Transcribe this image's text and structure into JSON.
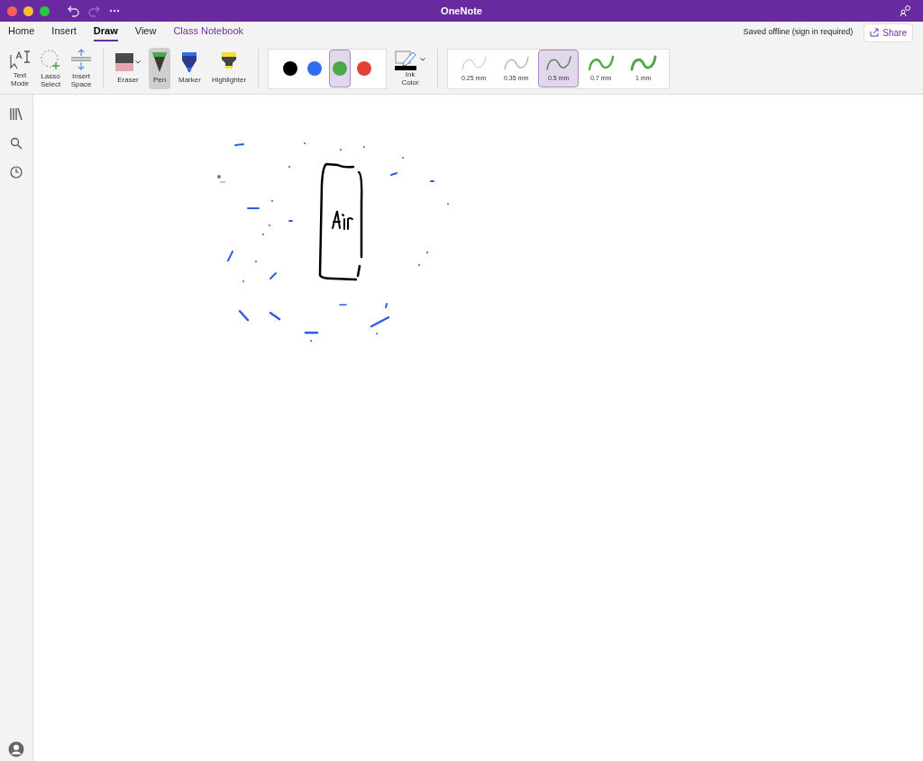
{
  "window": {
    "title": "OneNote"
  },
  "tabs": [
    {
      "label": "Home",
      "selected": false,
      "kind": "normal"
    },
    {
      "label": "Insert",
      "selected": false,
      "kind": "normal"
    },
    {
      "label": "Draw",
      "selected": true,
      "kind": "normal"
    },
    {
      "label": "View",
      "selected": false,
      "kind": "normal"
    },
    {
      "label": "Class Notebook",
      "selected": false,
      "kind": "accent"
    }
  ],
  "status": "Saved offline (sign in required)",
  "share_button": "Share",
  "mode_tools": [
    {
      "kind": "text",
      "label": "Text Mode"
    },
    {
      "kind": "lasso",
      "label": "Lasso Select"
    },
    {
      "kind": "space",
      "label": "Insert Space"
    }
  ],
  "pen_tools": [
    {
      "kind": "eraser",
      "label": "Eraser",
      "selected": false
    },
    {
      "kind": "pen",
      "label": "Pen",
      "selected": true
    },
    {
      "kind": "marker",
      "label": "Marker",
      "selected": false
    },
    {
      "kind": "highlighter",
      "label": "Highlighter",
      "selected": false
    }
  ],
  "colors": [
    {
      "color": "#000000",
      "selected": false
    },
    {
      "color": "#2f6ef0",
      "selected": false
    },
    {
      "color": "#4ea84a",
      "selected": true
    },
    {
      "color": "#e34234",
      "selected": false
    }
  ],
  "ink_color": {
    "label": "Ink Color"
  },
  "thicknesses": [
    {
      "label": "0.25 mm",
      "selected": false
    },
    {
      "label": "0.35 mm",
      "selected": false
    },
    {
      "label": "0.5 mm",
      "selected": true
    },
    {
      "label": "0.7 mm",
      "selected": false
    },
    {
      "label": "1 mm",
      "selected": false
    }
  ]
}
